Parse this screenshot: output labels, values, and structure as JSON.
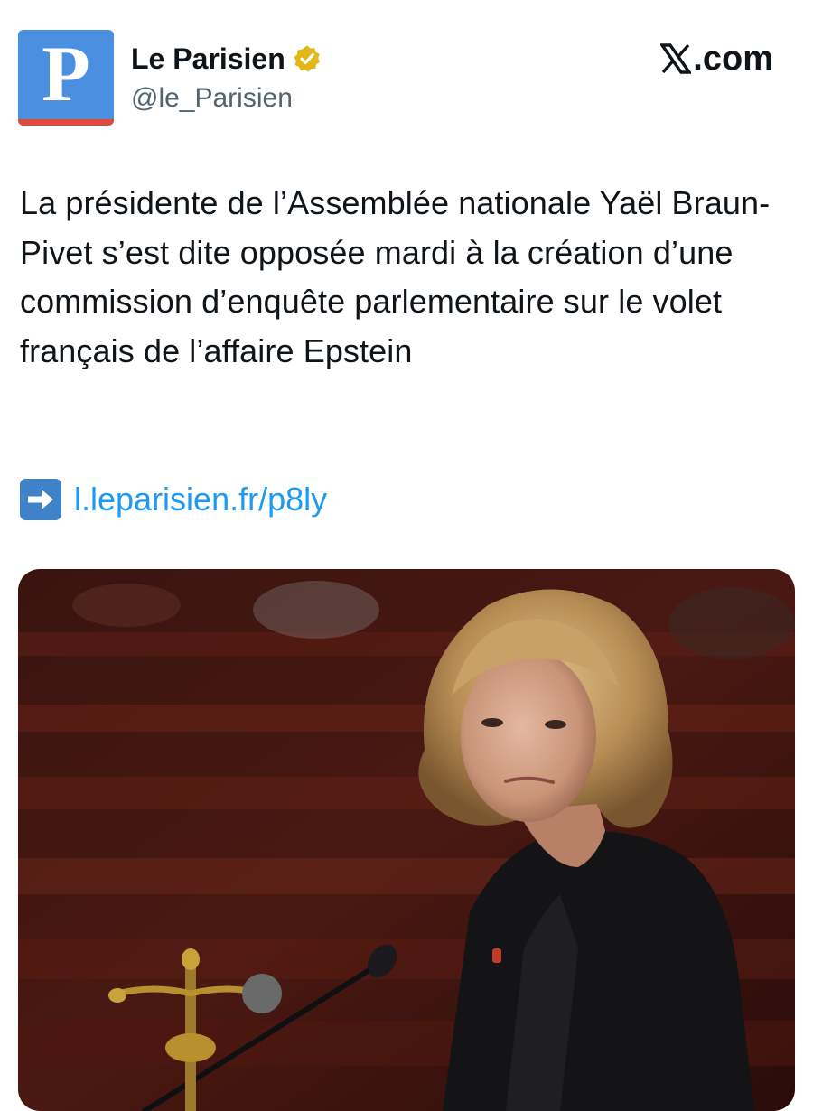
{
  "account": {
    "display_name": "Le Parisien",
    "handle": "@le_Parisien",
    "avatar_letter": "P",
    "avatar_color": "#4a8fe0",
    "avatar_stripe_color": "#e04a3c",
    "verified_badge_color": "#e2b719"
  },
  "brand": {
    "text": ".com",
    "icon": "x-logo-icon"
  },
  "tweet": {
    "text": "La présidente de l’Assemblée nationale Yaël Braun-Pivet s’est dite opposée mardi à la création d’une commission d’enquête parlementaire sur le volet français de l’affaire Epstein",
    "link_icon": "right-arrow-emoji-icon",
    "link": "l.leparisien.fr/p8ly",
    "link_color": "#1d9bf0"
  },
  "media": {
    "type": "photo"
  }
}
